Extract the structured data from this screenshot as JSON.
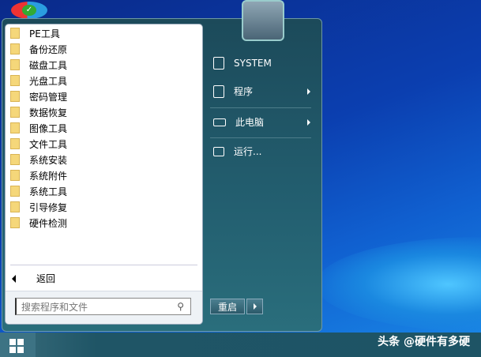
{
  "programs": [
    "PE工具",
    "备份还原",
    "磁盘工具",
    "光盘工具",
    "密码管理",
    "数据恢复",
    "图像工具",
    "文件工具",
    "系统安装",
    "系统附件",
    "系统工具",
    "引导修复",
    "硬件检测"
  ],
  "back_label": "返回",
  "search_placeholder": "搜索程序和文件",
  "right": {
    "user": "SYSTEM",
    "programs": "程序",
    "computer": "此电脑",
    "run": "运行..."
  },
  "restart_label": "重启",
  "watermark": "头条 @硬件有多硬"
}
